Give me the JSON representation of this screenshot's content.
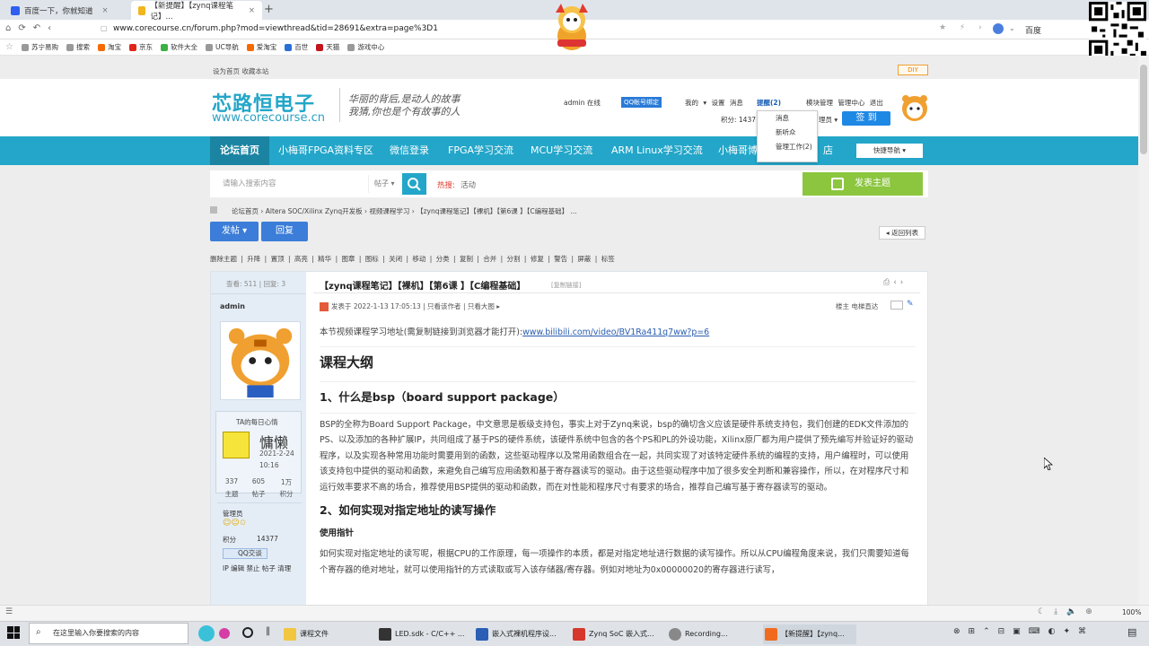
{
  "browser": {
    "tabs": [
      {
        "label": "百度一下，你就知道",
        "active": false
      },
      {
        "label": "【新提醒】【zynq课程笔记】...",
        "active": true
      }
    ],
    "url": "www.corecourse.cn/forum.php?mod=viewthread&tid=28691&extra=page%3D1",
    "search_engine": "百度",
    "bookmarks": [
      "苏宁易购",
      "搜索",
      "淘宝",
      "京东",
      "软件大全",
      "UC导航",
      "爱淘宝",
      "百世",
      "天猫",
      "游戏中心"
    ]
  },
  "site": {
    "toplinks": "设为首页 收藏本站",
    "diy": "DIY",
    "logo_cn": "芯路恒电子",
    "logo_url": "www.corecourse.cn",
    "slogan_line1": "华丽的背后,是动人的故事",
    "slogan_line2": "我猜,你也是个有故事的人",
    "user": "admin 在线",
    "qq_bind": "QQ帐号绑定",
    "user_links": "我的 ▾  设置  消息",
    "remind": "提醒(2)",
    "user_links2": "模块管理  管理中心  退出",
    "points": "积分: 1437",
    "member": "理员 ▾",
    "signin": "签 到",
    "dropdown": [
      "消息",
      "新听众",
      "管理工作(2)"
    ]
  },
  "nav": {
    "items": [
      "论坛首页",
      "小梅哥FPGA资料专区",
      "微信登录",
      "FPGA学习交流",
      "MCU学习交流",
      "ARM Linux学习交流",
      "小梅哥博",
      "店"
    ],
    "quicknav": "快捷导航 ▾"
  },
  "search": {
    "placeholder": "请输入搜索内容",
    "type": "帖子 ▾",
    "hot_label": "热搜:",
    "hot_link": "活动",
    "new_thread": "发表主题"
  },
  "breadcrumb": "论坛首页  ›  Altera SOC/Xilinx Zynq开发板  ›  视频课程学习  ›  【zynq课程笔记】【裸机】【第6课 】【C编程基础】 ...",
  "actions": {
    "post": "发帖 ▾",
    "reply": "回复",
    "back": "◂ 返回列表",
    "modbar": "删除主题 | 升降 | 置顶 | 高亮 | 精华 | 图章 | 图标 | 关闭 | 移动 | 分类 | 复制 | 合并 | 分割 | 修复 | 警告 | 屏蔽 | 标签"
  },
  "thread": {
    "views_replies": "查看: 511 | 回复: 3",
    "author": "admin",
    "mood_title": "TA的每日心情",
    "mood": "慵懒",
    "mood_date": "2021-2-24",
    "mood_time": "10:16",
    "stat_values": [
      "337",
      "605",
      "1万"
    ],
    "stat_labels": [
      "主题",
      "帖子",
      "积分"
    ],
    "group": "管理员",
    "points_label": "积分",
    "points_value": "14377",
    "qq_badge": "QQ交谈",
    "ip_line": "IP 编辑 禁止 帖子 清理",
    "title": "【zynq课程笔记】【裸机】【第6课 】【C编程基础】",
    "copy_link": "[复制链接]",
    "meta": "发表于 2022-1-13 17:05:13  |  只看该作者  |  只看大图 ▸",
    "floor": "楼主   电梯直达"
  },
  "content": {
    "intro": "本节视频课程学习地址(需复制链接到浏览器才能打开):",
    "link": "www.bilibili.com/video/BV1Ra411q7ww?p=6",
    "h_outline": "课程大纲",
    "h1": "1、什么是bsp（board support package）",
    "p1": "BSP的全称为Board Support Package，中文意思是板级支持包，事实上对于Zynq来说，bsp的确切含义应该是硬件系统支持包，我们创建的EDK文件添加的PS、以及添加的各种扩展IP，共同组成了基于PS的硬件系统，该硬件系统中包含的各个PS和PL的外设功能，Xilinx原厂都为用户提供了预先编写并验证好的驱动程序，以及实现各种常用功能时需要用到的函数，这些驱动程序以及常用函数组合在一起，共同实现了对该特定硬件系统的编程的支持，用户编程时，可以使用该支持包中提供的驱动和函数，来避免自己编写应用函数和基于寄存器读写的驱动。由于这些驱动程序中加了很多安全判断和兼容操作，所以，在对程序尺寸和运行效率要求不高的场合，推荐使用BSP提供的驱动和函数，而在对性能和程序尺寸有要求的场合，推荐自己编写基于寄存器读写的驱动。",
    "h2": "2、如何实现对指定地址的读写操作",
    "h2_sub": "使用指针",
    "p2": "如何实现对指定地址的读写呢，根据CPU的工作原理，每一项操作的本质，都是对指定地址进行数据的读写操作。所以从CPU编程角度来说，我们只需要知道每个寄存器的绝对地址，就可以使用指针的方式读取或写入该存储器/寄存器。例如对地址为0x00000020的寄存器进行读写，"
  },
  "statusbar": {
    "zoom": "100%"
  },
  "taskbar": {
    "search_placeholder": "在这里输入你要搜索的内容",
    "items": [
      "课程文件",
      "LED.sdk - C/C++ ...",
      "嵌入式裸机程序设...",
      "Zynq SoC 嵌入式...",
      "Recording...",
      "【新提醒】【zynq..."
    ],
    "time": "",
    "colors": {
      "accent": "#23a6c9",
      "green": "#8cc63f",
      "blue": "#3b7dd8"
    }
  }
}
